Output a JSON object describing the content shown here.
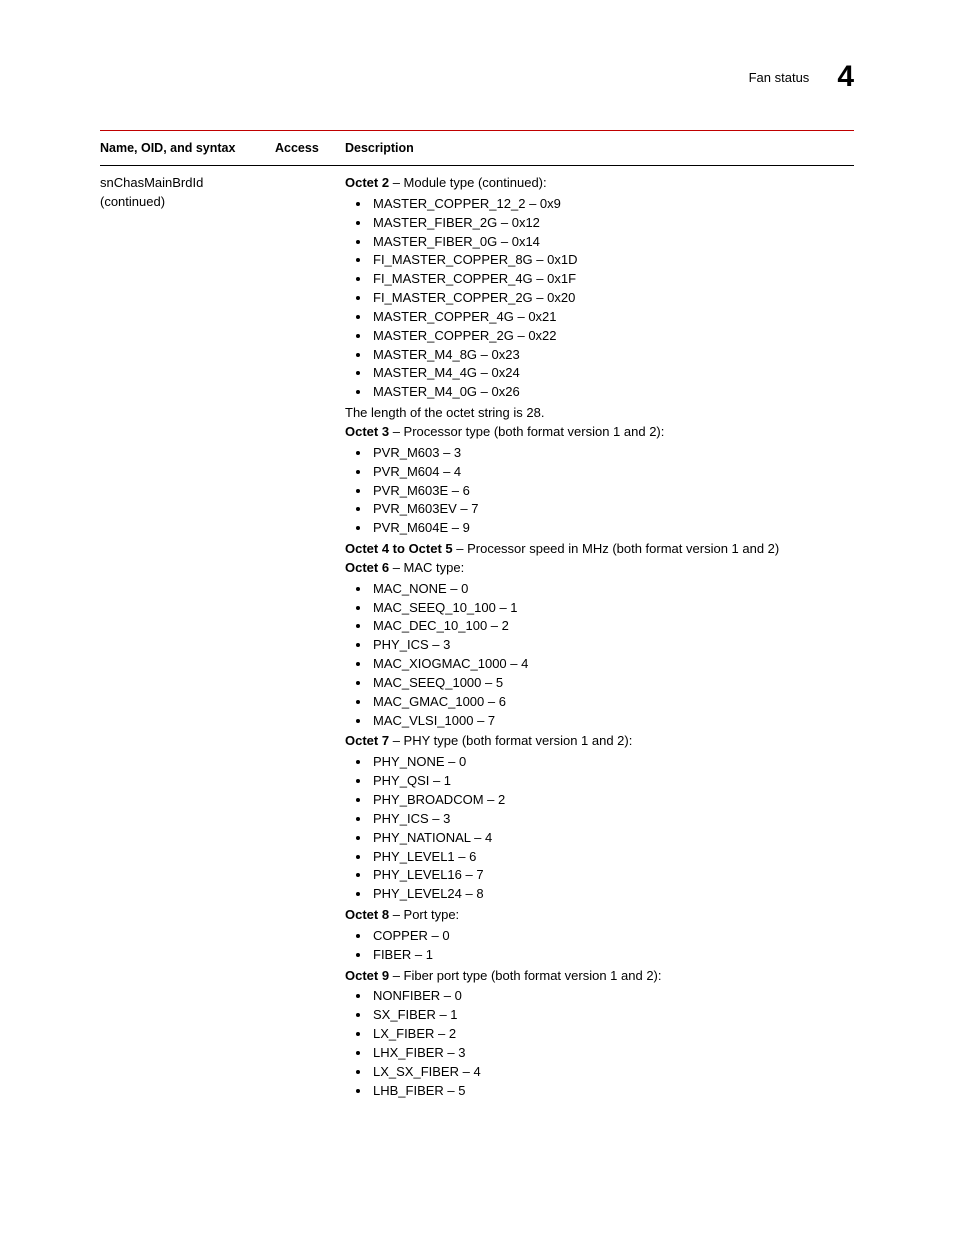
{
  "header": {
    "title": "Fan status",
    "chapter": "4"
  },
  "columns": {
    "c1": "Name, OID, and syntax",
    "c2": "Access",
    "c3": "Description"
  },
  "row": {
    "name_line1": "snChasMainBrdId",
    "name_line2": "(continued)",
    "access": ""
  },
  "desc": {
    "octet2_label": "Octet 2",
    "octet2_text": " – Module type (continued):",
    "octet2_items": [
      "MASTER_COPPER_12_2 – 0x9",
      "MASTER_FIBER_2G – 0x12",
      "MASTER_FIBER_0G – 0x14",
      "FI_MASTER_COPPER_8G – 0x1D",
      "FI_MASTER_COPPER_4G – 0x1F",
      "FI_MASTER_COPPER_2G – 0x20",
      "MASTER_COPPER_4G – 0x21",
      "MASTER_COPPER_2G – 0x22",
      "MASTER_M4_8G – 0x23",
      "MASTER_M4_4G – 0x24",
      "MASTER_M4_0G – 0x26"
    ],
    "len_note": "The length of the octet string is 28.",
    "octet3_label": "Octet 3",
    "octet3_text": " – Processor type (both format version 1 and 2):",
    "octet3_items": [
      "PVR_M603 – 3",
      "PVR_M604 – 4",
      "PVR_M603E – 6",
      "PVR_M603EV – 7",
      "PVR_M604E – 9"
    ],
    "octet4_label": "Octet 4 to Octet 5",
    "octet4_text": " – Processor speed in MHz (both format version 1 and 2)",
    "octet6_label": "Octet 6",
    "octet6_text": " – MAC type:",
    "octet6_items": [
      "MAC_NONE – 0",
      "MAC_SEEQ_10_100 – 1",
      "MAC_DEC_10_100 – 2",
      "PHY_ICS – 3",
      "MAC_XIOGMAC_1000 – 4",
      "MAC_SEEQ_1000 – 5",
      "MAC_GMAC_1000 – 6",
      "MAC_VLSI_1000 – 7"
    ],
    "octet7_label": "Octet 7",
    "octet7_text": " – PHY type (both format version 1 and 2):",
    "octet7_items": [
      "PHY_NONE – 0",
      "PHY_QSI – 1",
      "PHY_BROADCOM – 2",
      "PHY_ICS – 3",
      "PHY_NATIONAL – 4",
      "PHY_LEVEL1 – 6",
      "PHY_LEVEL16 – 7",
      "PHY_LEVEL24 – 8"
    ],
    "octet8_label": "Octet 8",
    "octet8_text": " – Port type:",
    "octet8_items": [
      "COPPER – 0",
      "FIBER – 1"
    ],
    "octet9_label": "Octet 9",
    "octet9_text": " – Fiber port type (both format version 1 and 2):",
    "octet9_items": [
      "NONFIBER – 0",
      "SX_FIBER – 1",
      "LX_FIBER – 2",
      "LHX_FIBER – 3",
      "LX_SX_FIBER – 4",
      "LHB_FIBER – 5"
    ]
  }
}
